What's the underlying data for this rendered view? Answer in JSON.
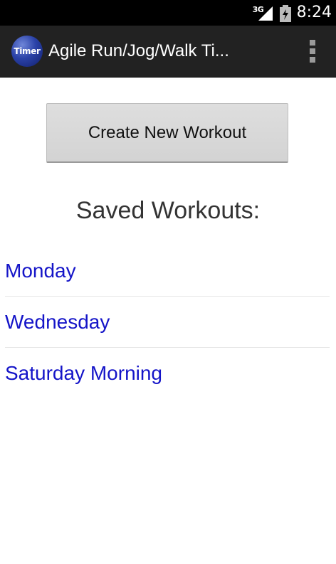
{
  "status_bar": {
    "network_type": "3G",
    "time": "8:24",
    "icons": [
      "signal-icon",
      "battery-icon"
    ]
  },
  "action_bar": {
    "app_icon_label": "Timer",
    "title": "Agile Run/Jog/Walk Ti...",
    "overflow_icon": "overflow-menu-icon"
  },
  "main": {
    "create_button_label": "Create New Workout",
    "saved_heading": "Saved Workouts:",
    "workouts": [
      {
        "label": "Monday"
      },
      {
        "label": "Wednesday"
      },
      {
        "label": "Saturday Morning"
      }
    ]
  },
  "colors": {
    "status_bar_bg": "#000000",
    "action_bar_bg": "#222222",
    "link_blue": "#1414c8",
    "button_gray": "#d8d8d8"
  }
}
